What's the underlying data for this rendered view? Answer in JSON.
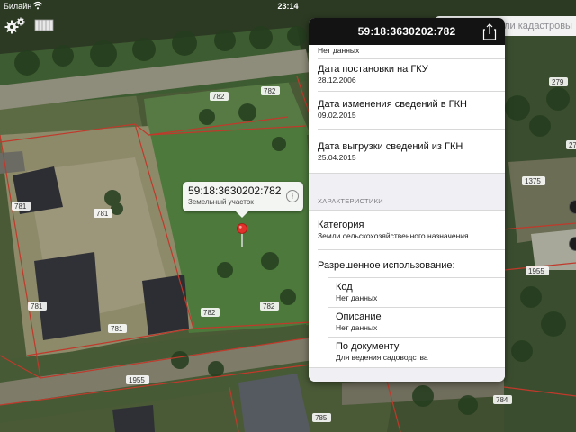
{
  "status_bar": {
    "carrier": "Билайн",
    "time": "23:14"
  },
  "search": {
    "placeholder": "ьный номер или кадастровы"
  },
  "map": {
    "parcel_labels": [
      "782",
      "782",
      "781",
      "781",
      "781",
      "782",
      "782",
      "781",
      "1955",
      "785",
      "784",
      "279",
      "1375",
      "1955",
      "27"
    ]
  },
  "callout": {
    "title": "59:18:3630202:782",
    "subtitle": "Земельный участок"
  },
  "panel": {
    "title": "59:18:3630202:782",
    "top_value": "Нет данных",
    "fields": [
      {
        "label": "Дата постановки на ГКУ",
        "value": "28.12.2006"
      },
      {
        "label": "Дата изменения сведений в ГКН",
        "value": "09.02.2015"
      },
      {
        "label": "Дата выгрузки сведений из ГКН",
        "value": "25.04.2015"
      }
    ],
    "section_title": "ХАРАКТЕРИСТИКИ",
    "category": {
      "label": "Категория",
      "value": "Земли сельскохозяйственного назначения"
    },
    "permitted_use": {
      "label": "Разрешенное использование:",
      "items": [
        {
          "label": "Код",
          "value": "Нет данных"
        },
        {
          "label": "Описание",
          "value": "Нет данных"
        },
        {
          "label": "По документу",
          "value": "Для ведения садоводства"
        }
      ]
    }
  },
  "colors": {
    "panel_header": "#131313",
    "parcel_line": "#c0392b",
    "pin": "#e0312a"
  }
}
